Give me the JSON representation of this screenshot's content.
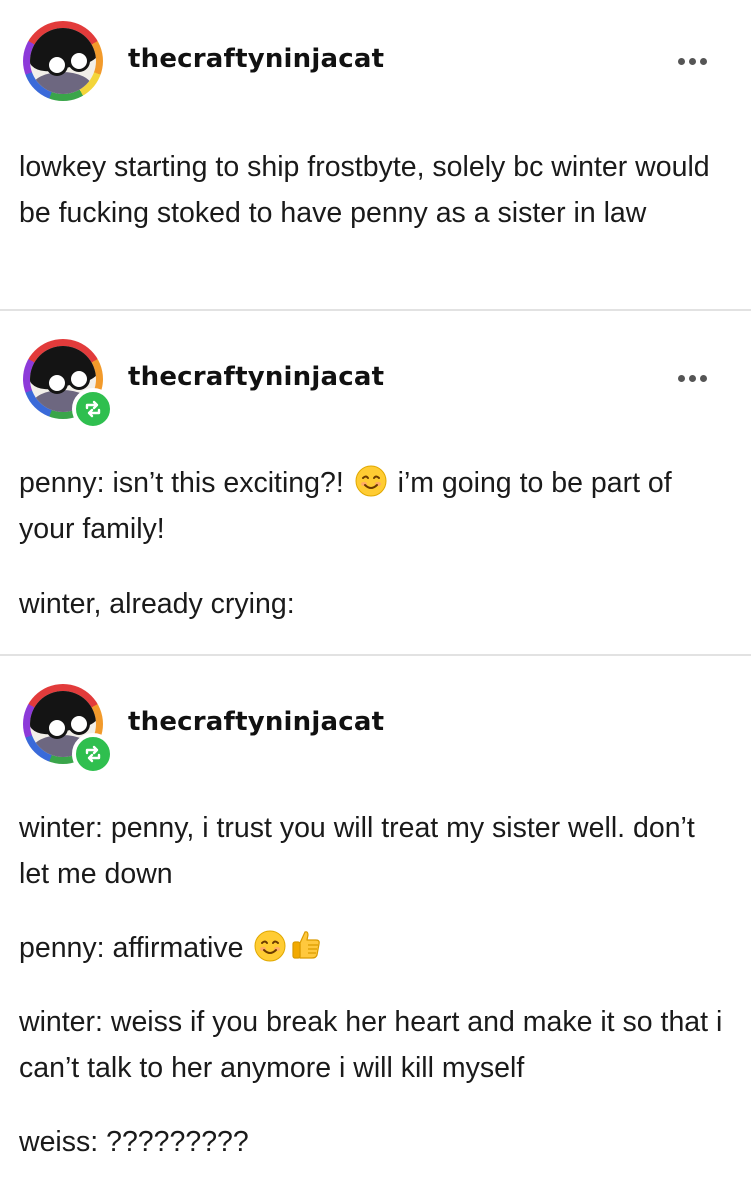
{
  "posts": [
    {
      "username": "thecraftyninjacat",
      "has_more_menu": true,
      "is_reblog": false,
      "paragraphs": [
        "lowkey starting to ship frostbyte, solely bc winter would be fucking stoked to have penny as a sister in law"
      ]
    },
    {
      "username": "thecraftyninjacat",
      "has_more_menu": true,
      "is_reblog": true,
      "paragraphs": [
        {
          "before": "penny: isn’t this exciting?! ",
          "emoji": "smiling-face-emoji",
          "after": " i’m going to be part of your family!"
        },
        "winter, already crying:"
      ]
    },
    {
      "username": "thecraftyninjacat",
      "has_more_menu": false,
      "is_reblog": true,
      "paragraphs": [
        "winter: penny, i trust you will treat my sister well. don’t let me down",
        {
          "before": "penny: affirmative ",
          "emoji": "smiling-face-emoji thumbs-up-emoji",
          "after": ""
        },
        "winter: weiss if you break her heart and make it so that i can’t talk to her anymore i will kill myself",
        "weiss: ?????????"
      ]
    }
  ],
  "colors": {
    "reblog_badge": "#2fbf4f",
    "divider": "#e2e2e2",
    "text": "#1a1a1a"
  }
}
